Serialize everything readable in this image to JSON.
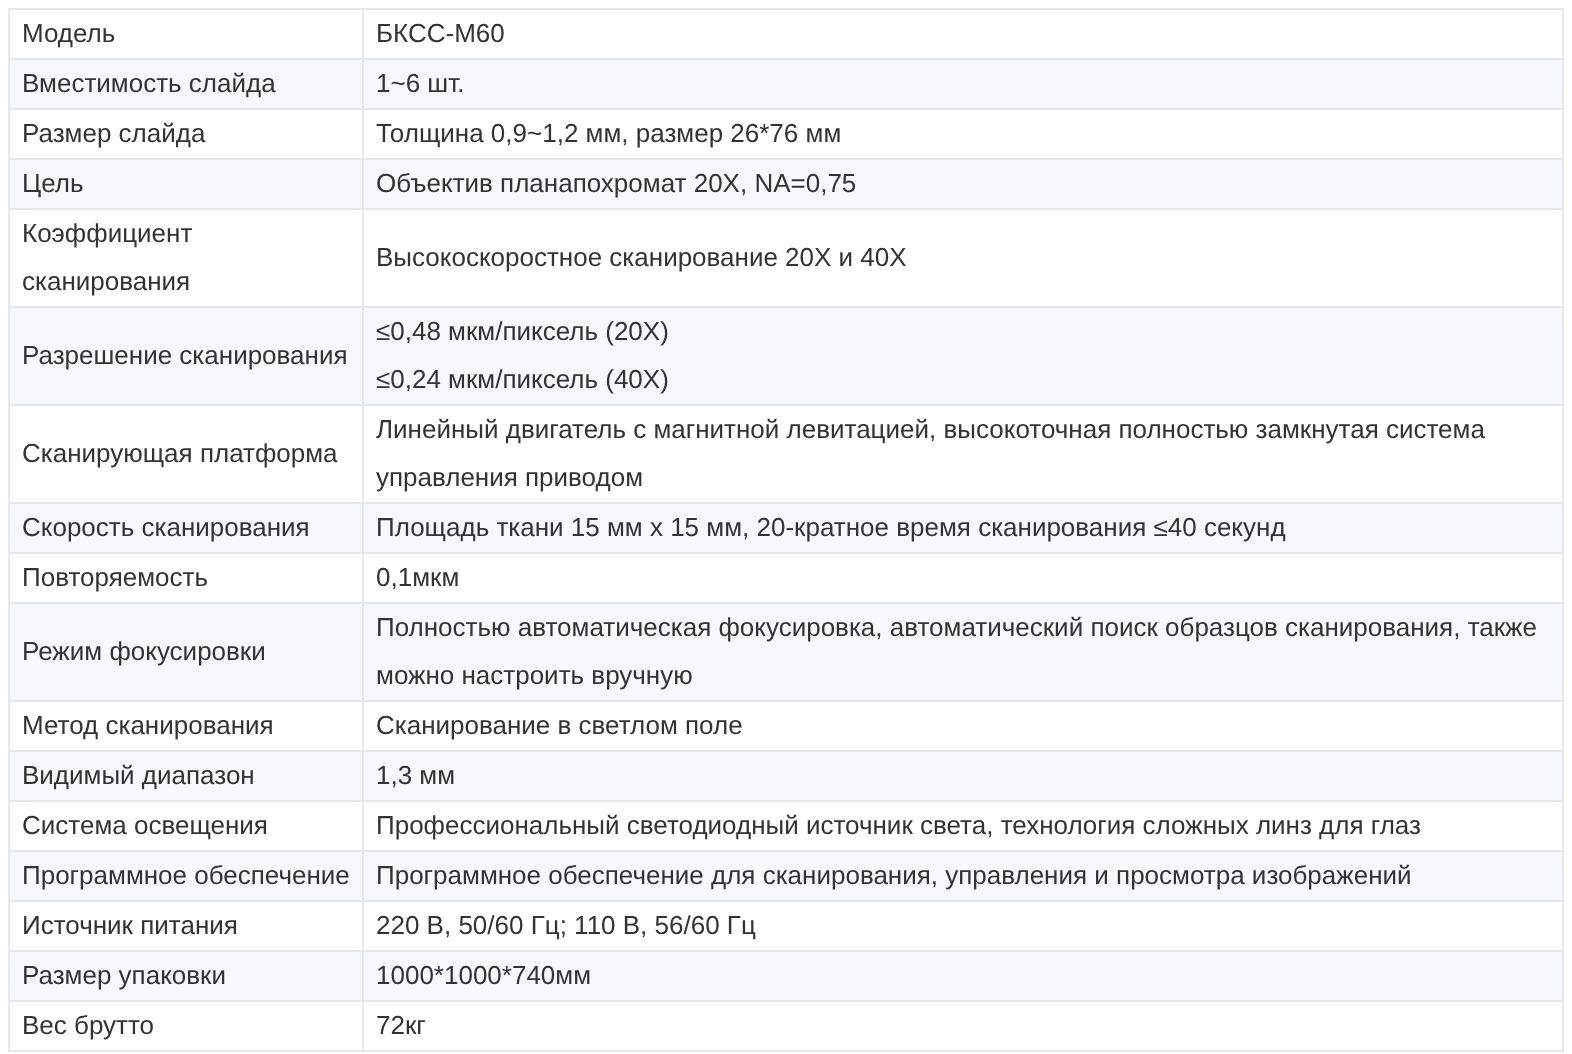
{
  "rows": [
    {
      "label": "Модель",
      "value": [
        "БКСС-М60"
      ]
    },
    {
      "label": "Вместимость слайда",
      "value": [
        "1~6 шт."
      ]
    },
    {
      "label": "Размер слайда",
      "value": [
        "Толщина 0,9~1,2 мм, размер 26*76 мм"
      ]
    },
    {
      "label": "Цель",
      "value": [
        "Объектив планапохромат 20X, NA=0,75"
      ]
    },
    {
      "label": "Коэффициент сканирования",
      "value": [
        "Высокоскоростное сканирование 20X и 40X"
      ]
    },
    {
      "label": "Разрешение сканирования",
      "value": [
        "≤0,48 мкм/пиксель (20X)",
        "≤0,24 мкм/пиксель (40X)"
      ]
    },
    {
      "label": "Сканирующая платформа",
      "value": [
        "Линейный двигатель с магнитной левитацией, высокоточная полностью замкнутая система управления приводом"
      ]
    },
    {
      "label": "Скорость сканирования",
      "value": [
        "Площадь ткани 15 мм x 15 мм, 20-кратное время сканирования ≤40 секунд"
      ]
    },
    {
      "label": "Повторяемость",
      "value": [
        "0,1мкм"
      ]
    },
    {
      "label": "Режим фокусировки",
      "value": [
        "Полностью автоматическая фокусировка, автоматический поиск образцов сканирования, также можно настроить вручную"
      ]
    },
    {
      "label": "Метод сканирования",
      "value": [
        "Сканирование в светлом поле"
      ]
    },
    {
      "label": "Видимый диапазон",
      "value": [
        "1,3 мм"
      ]
    },
    {
      "label": "Система освещения",
      "value": [
        "Профессиональный светодиодный источник света, технология сложных линз для глаз"
      ]
    },
    {
      "label": "Программное обеспечение",
      "value": [
        "Программное обеспечение для сканирования, управления и просмотра изображений"
      ]
    },
    {
      "label": "Источник питания",
      "value": [
        "220 В, 50/60 Гц; 110 В, 56/60 Гц"
      ]
    },
    {
      "label": "Размер упаковки",
      "value": [
        "1000*1000*740мм"
      ]
    },
    {
      "label": "Вес брутто",
      "value": [
        "72кг"
      ]
    }
  ]
}
